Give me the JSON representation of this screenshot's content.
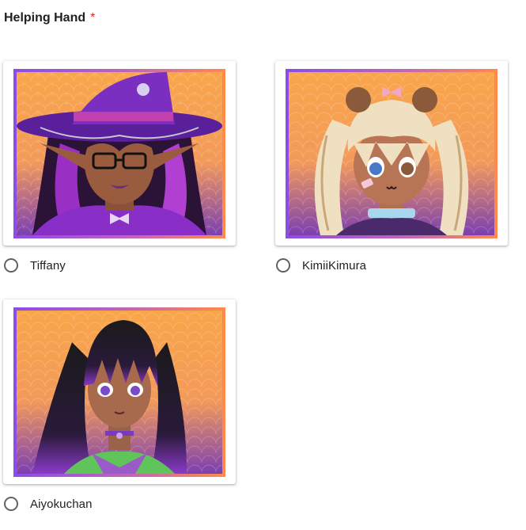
{
  "question": {
    "title": "Helping Hand",
    "required_marker": "*"
  },
  "options": [
    {
      "label": "Tiffany",
      "selected": false
    },
    {
      "label": "KimiiKimura",
      "selected": false
    },
    {
      "label": "Aiyokuchan",
      "selected": false
    }
  ],
  "colors": {
    "frame_start": "#8b4ce6",
    "frame_end": "#ff8a4a",
    "background_orange": "#f7a04a",
    "background_purple": "#7b3fb0",
    "required_star": "#d93025"
  }
}
